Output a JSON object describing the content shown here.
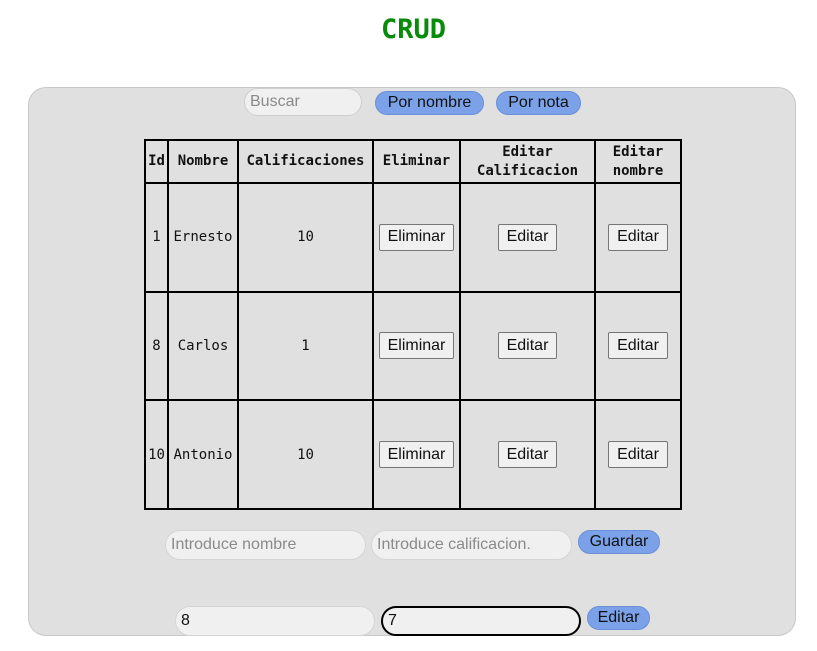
{
  "header": {
    "title": "CRUD"
  },
  "search": {
    "placeholder": "Buscar",
    "by_name_label": "Por nombre",
    "by_grade_label": "Por nota"
  },
  "table": {
    "headers": [
      "Id",
      "Nombre",
      "Calificaciones",
      "Eliminar",
      "Editar Calificacion",
      "Editar nombre"
    ],
    "rows": [
      {
        "id": "1",
        "name": "Ernesto",
        "grade": "10",
        "delete_label": "Eliminar",
        "edit_grade_label": "Editar",
        "edit_name_label": "Editar"
      },
      {
        "id": "8",
        "name": "Carlos",
        "grade": "1",
        "delete_label": "Eliminar",
        "edit_grade_label": "Editar",
        "edit_name_label": "Editar"
      },
      {
        "id": "10",
        "name": "Antonio",
        "grade": "10",
        "delete_label": "Eliminar",
        "edit_grade_label": "Editar",
        "edit_name_label": "Editar"
      }
    ]
  },
  "add_form": {
    "name_placeholder": "Introduce nombre",
    "grade_placeholder": "Introduce calificacion.",
    "save_label": "Guardar"
  },
  "edit_form": {
    "id_value": "8",
    "grade_value": "7",
    "edit_label": "Editar"
  },
  "colors": {
    "title": "#0a8a0a",
    "accent_button": "#7ba1e8",
    "panel": "#e0e0e0"
  }
}
